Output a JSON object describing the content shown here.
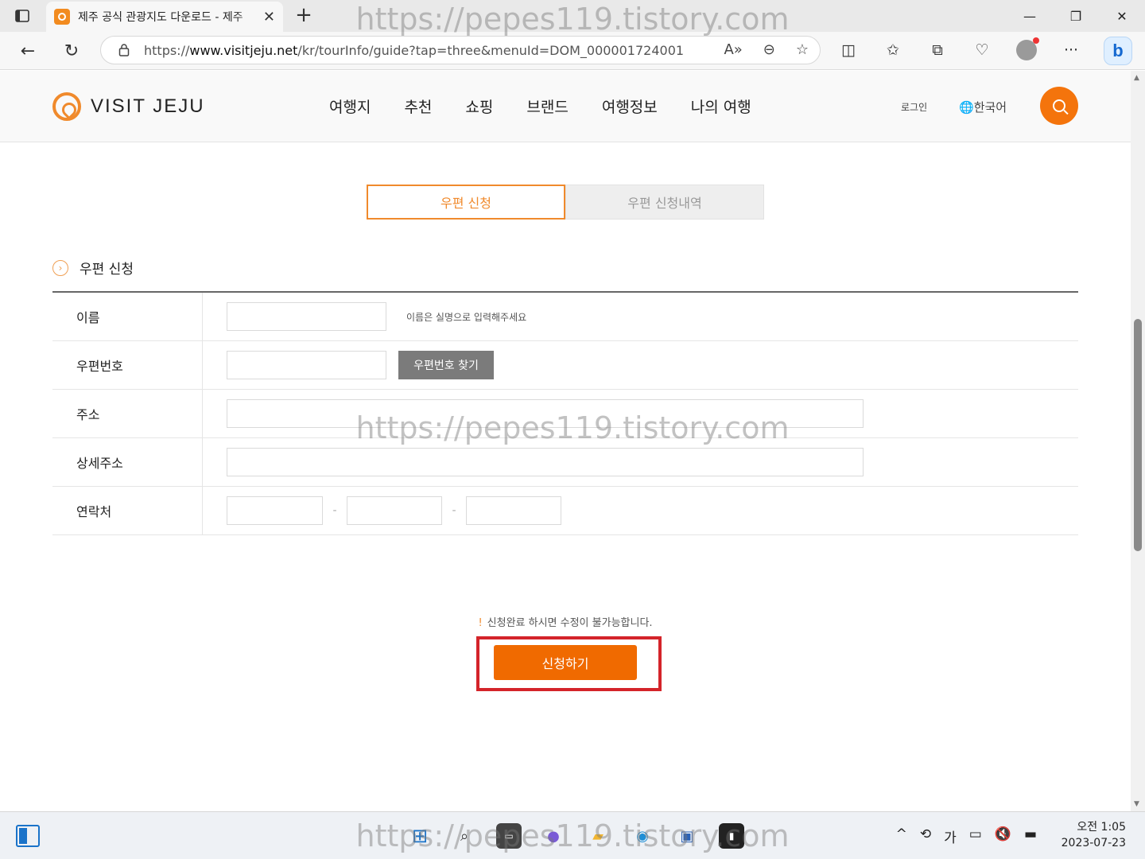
{
  "browser": {
    "tab_title": "제주 공식 관광지도 다운로드 - 제주",
    "tab_close": "✕",
    "new_tab": "+",
    "url_prefix": "https://",
    "url_domain": "www.visitjeju.net",
    "url_rest": "/kr/tourInfo/guide?tap=three&menuId=DOM_0000017240010...",
    "window_controls": [
      "—",
      "❐",
      "✕"
    ]
  },
  "site": {
    "logo_text": "VISIT JEJU",
    "nav": [
      "여행지",
      "추천",
      "쇼핑",
      "브랜드",
      "여행정보",
      "나의 여행"
    ],
    "login": "로그인",
    "language": "한국어",
    "brand_color": "#f4740c"
  },
  "tabs": {
    "active": "우편 신청",
    "inactive": "우편 신청내역"
  },
  "section": {
    "title": "우편 신청"
  },
  "form": {
    "name_label": "이름",
    "name_hint": "이름은 실명으로 입력해주세요",
    "zip_label": "우편번호",
    "zip_button": "우편번호 찾기",
    "address_label": "주소",
    "detail_label": "상세주소",
    "phone_label": "연락처",
    "phone_sep": "-"
  },
  "notice": {
    "mark": "!",
    "text": "신청완료 하시면 수정이 불가능합니다."
  },
  "submit_label": "신청하기",
  "watermark": "https://pepes119.tistory.com",
  "taskbar": {
    "time": "오전 1:05",
    "date": "2023-07-23",
    "ime": "가"
  }
}
